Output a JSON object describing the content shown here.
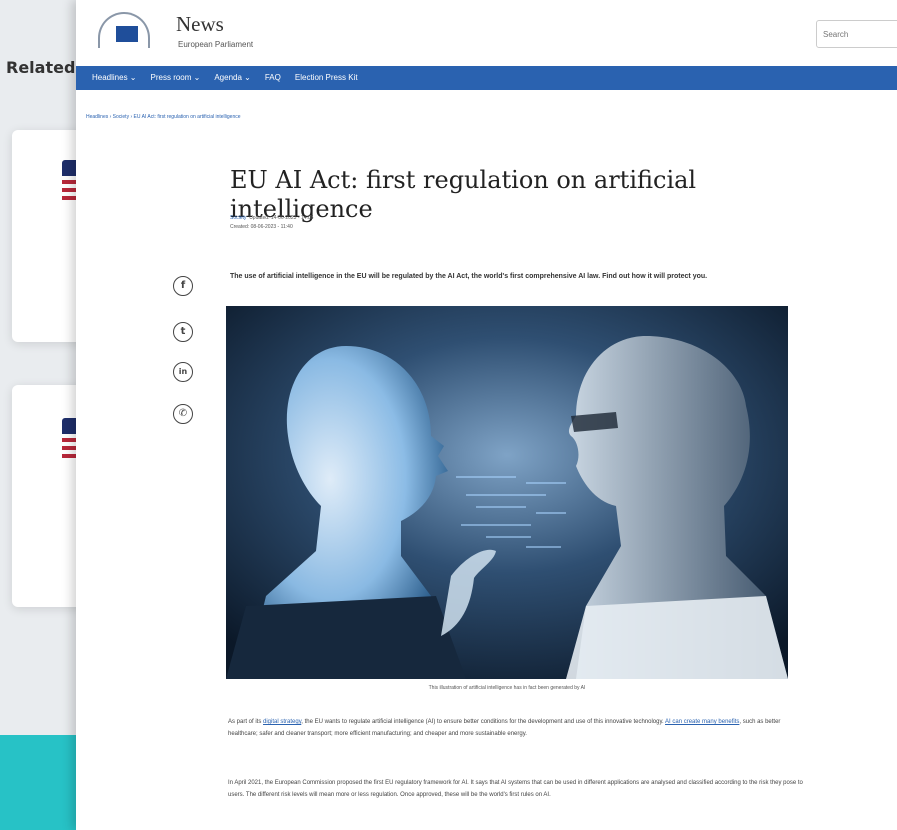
{
  "background": {
    "related_label": "Related"
  },
  "header": {
    "site_title": "News",
    "site_subtitle": "European Parliament",
    "search_placeholder": "Search"
  },
  "nav": {
    "items": [
      {
        "label": "Headlines ⌄"
      },
      {
        "label": "Press room ⌄"
      },
      {
        "label": "Agenda ⌄"
      },
      {
        "label": "FAQ"
      },
      {
        "label": "Election Press Kit"
      }
    ]
  },
  "breadcrumb": "Headlines › Society › EU AI Act: first regulation on artificial intelligence",
  "article": {
    "title": "EU AI Act: first regulation on artificial intelligence",
    "category": "Society",
    "updated": "Updated: 14-06-2023 - 14:06",
    "created": "Created: 08-06-2023 - 11:40",
    "lead": "The use of artificial intelligence in the EU will be regulated by the AI Act, the world's first comprehensive AI law. Find out how it will protect you.",
    "image_caption": "This illustration of artificial intelligence has in fact been generated by AI",
    "paragraph1_before": "As part of its ",
    "paragraph1_link1": "digital strategy",
    "paragraph1_mid": ", the EU wants to regulate artificial intelligence (AI) to ensure better conditions for the development and use of this innovative technology. ",
    "paragraph1_link2": "AI can create many benefits",
    "paragraph1_after": ", such as better healthcare; safer and cleaner transport; more efficient manufacturing; and cheaper and more sustainable energy.",
    "paragraph2": "In April 2021, the European Commission proposed the first EU regulatory framework for AI. It says that AI systems that can be used in different applications are analysed and classified according to the risk they pose to users. The different risk levels will mean more or less regulation. Once approved, these will be the world's first rules on AI."
  },
  "share_icons": [
    {
      "glyph": "f",
      "name": "facebook-icon"
    },
    {
      "glyph": "t",
      "name": "twitter-icon"
    },
    {
      "glyph": "in",
      "name": "linkedin-icon"
    },
    {
      "glyph": "✆",
      "name": "whatsapp-icon"
    }
  ],
  "colors": {
    "nav_bg": "#2a62b0",
    "link": "#2a62b0",
    "teal": "#27c2c6"
  }
}
